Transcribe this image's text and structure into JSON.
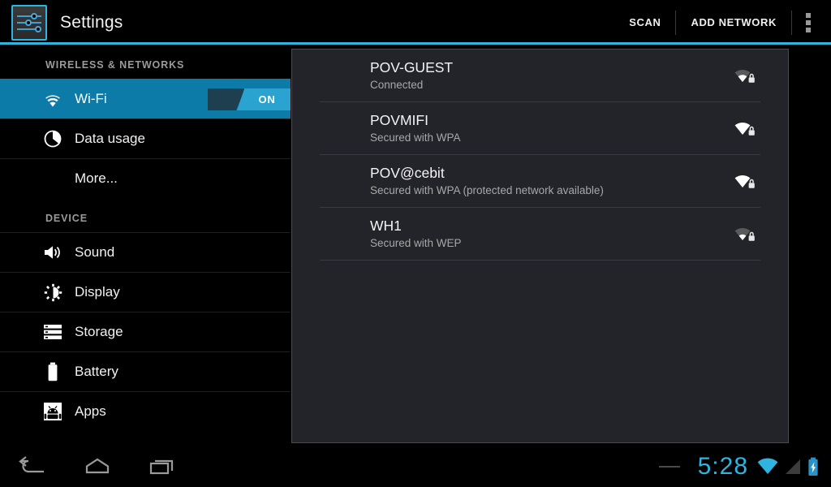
{
  "action_bar": {
    "app_icon": "settings-sliders-icon",
    "title": "Settings",
    "scan_label": "SCAN",
    "add_network_label": "ADD NETWORK",
    "overflow_label": "overflow-menu",
    "accent_color": "#2fb4e0"
  },
  "sidebar": {
    "sections": [
      {
        "header": "WIRELESS & NETWORKS",
        "items": [
          {
            "label": "Wi-Fi",
            "icon": "wifi-icon",
            "selected": true,
            "toggle": "ON"
          },
          {
            "label": "Data usage",
            "icon": "data-usage-icon",
            "selected": false
          },
          {
            "label": "More...",
            "icon": "",
            "selected": false
          }
        ]
      },
      {
        "header": "DEVICE",
        "items": [
          {
            "label": "Sound",
            "icon": "sound-icon",
            "selected": false
          },
          {
            "label": "Display",
            "icon": "display-icon",
            "selected": false
          },
          {
            "label": "Storage",
            "icon": "storage-icon",
            "selected": false
          },
          {
            "label": "Battery",
            "icon": "battery-icon",
            "selected": false
          },
          {
            "label": "Apps",
            "icon": "apps-icon",
            "selected": false
          }
        ]
      }
    ],
    "selected_color": "#0c7ba8"
  },
  "wifi_networks": [
    {
      "ssid": "POV-GUEST",
      "status": "Connected",
      "signal": "weak",
      "locked": true
    },
    {
      "ssid": "POVMIFI",
      "status": "Secured with WPA",
      "signal": "strong",
      "locked": true
    },
    {
      "ssid": "POV@cebit",
      "status": "Secured with WPA (protected network available)",
      "signal": "strong",
      "locked": true
    },
    {
      "ssid": "WH1",
      "status": "Secured with WEP",
      "signal": "weak",
      "locked": true
    }
  ],
  "nav_bar": {
    "back": "back-icon",
    "home": "home-icon",
    "recents": "recent-apps-icon",
    "clock": "5:28",
    "wifi_status": "wifi-status-icon",
    "signal_status": "cell-signal-icon",
    "battery_status": "battery-charging-icon",
    "clock_color": "#2fb4e0"
  }
}
